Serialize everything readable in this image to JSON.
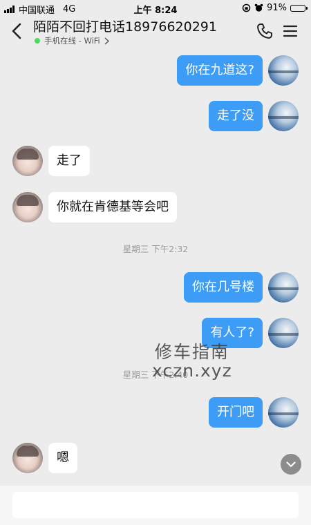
{
  "status_bar": {
    "carrier": "中国联通",
    "network": "4G",
    "time": "上午 8:24",
    "battery": "91%"
  },
  "header": {
    "title": "陌陌不回打电话18976620291",
    "online_status": "手机在线 - WiFi",
    "online_color": "#4cd964"
  },
  "messages": [
    {
      "side": "right",
      "text": "你在九道这?"
    },
    {
      "side": "right",
      "text": "走了没"
    },
    {
      "side": "left",
      "text": "走了"
    },
    {
      "side": "left",
      "text": "你就在肯德基等会吧"
    },
    {
      "type": "time",
      "text": "星期三 下午2:32"
    },
    {
      "side": "right",
      "text": "你在几号楼"
    },
    {
      "side": "right",
      "text": "有人了?"
    },
    {
      "type": "time",
      "text": "星期三 下午2:40"
    },
    {
      "side": "right",
      "text": "开门吧"
    },
    {
      "side": "left",
      "text": "嗯"
    }
  ],
  "watermark": {
    "line1": "修车指南",
    "line2": "xczn.xyz"
  },
  "input": {
    "placeholder": ""
  },
  "colors": {
    "sent_bubble": "#3d9cf5",
    "received_bubble": "#ffffff",
    "background": "#ececec"
  },
  "icons": {
    "back": "chevron-left-icon",
    "call": "phone-icon",
    "menu": "menu-icon",
    "scroll": "chevron-down-icon"
  }
}
